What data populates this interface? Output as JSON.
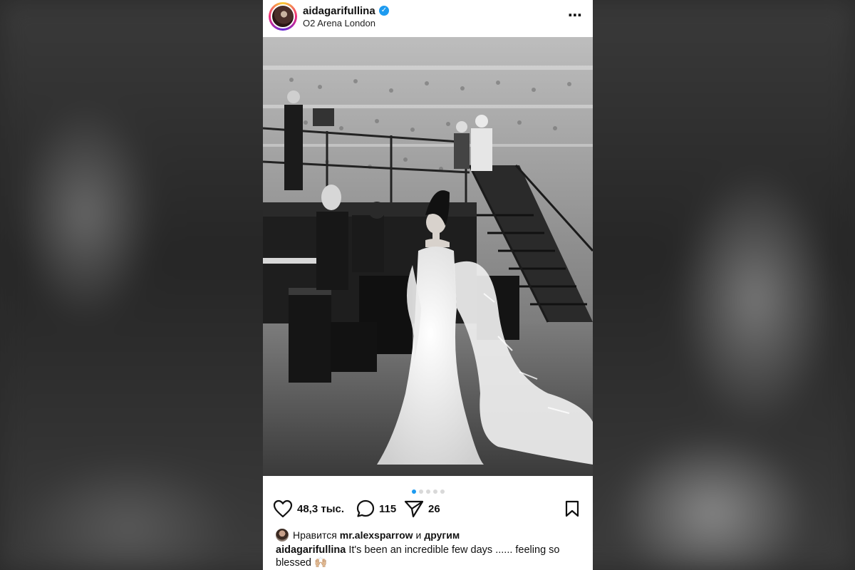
{
  "post": {
    "username": "aidagarifullina",
    "location": "O2 Arena London",
    "verified_mark": "✓",
    "more_icon": "⋯",
    "image_description_icon": "photo",
    "carousel_count": 5,
    "carousel_active_index": 0
  },
  "actions": {
    "likes_count": "48,3 тыс.",
    "comments_count": "115",
    "shares_count": "26"
  },
  "likes_line": {
    "prefix": "Нравится",
    "user": "mr.alexsparrow",
    "joiner": "и",
    "others": "другим"
  },
  "caption": {
    "username": "aidagarifullina",
    "text": "It's been an incredible few days ...... feeling so blessed 🙌🏼"
  },
  "colors": {
    "accent": "#1d9bf0",
    "text": "#111111",
    "background": "#ffffff"
  }
}
